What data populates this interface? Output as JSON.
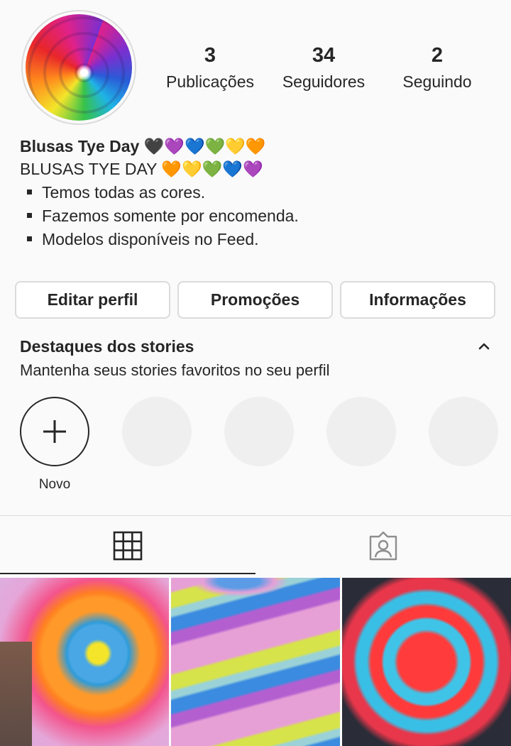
{
  "profile": {
    "stats": [
      {
        "value": "3",
        "label": "Publicações"
      },
      {
        "value": "34",
        "label": "Seguidores"
      },
      {
        "value": "2",
        "label": "Seguindo"
      }
    ],
    "name": "Blusas Tye Day 🖤💜💙💚💛🧡",
    "bio_line": "BLUSAS TYE DAY 🧡💛💚💙💜",
    "bio_bullets": [
      "Temos todas as cores.",
      "Fazemos somente por encomenda.",
      "Modelos disponíveis no Feed."
    ]
  },
  "buttons": {
    "edit": "Editar perfil",
    "promotions": "Promoções",
    "info": "Informações"
  },
  "highlights": {
    "title": "Destaques dos stories",
    "subtitle": "Mantenha seus stories favoritos no seu perfil",
    "new_label": "Novo"
  },
  "tabs": {
    "grid_icon": "grid-icon",
    "tagged_icon": "tagged-person-icon"
  },
  "colors": {
    "text": "#262626",
    "border": "#dbdbdb",
    "background": "#fafafa",
    "placeholder": "#efefef"
  }
}
